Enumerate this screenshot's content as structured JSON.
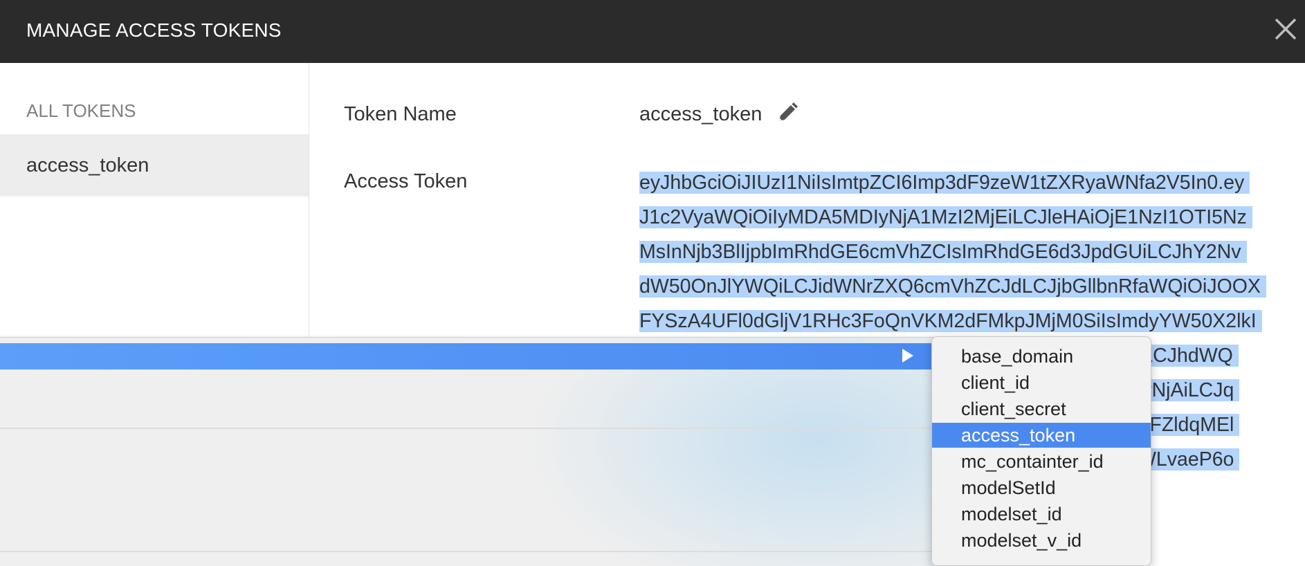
{
  "dialog": {
    "title": "MANAGE ACCESS TOKENS",
    "close_icon": "close-icon"
  },
  "sidebar": {
    "header": "ALL TOKENS",
    "items": [
      {
        "label": "access_token",
        "selected": true
      }
    ]
  },
  "detail": {
    "token_name_label": "Token Name",
    "token_name_value": "access_token",
    "edit_icon": "pencil-icon",
    "access_token_label": "Access Token",
    "access_token_lines": [
      "eyJhbGciOiJIUzI1NiIsImtpZCI6Imp3dF9zeW1tZXRyaWNfa2V5In0.ey",
      "J1c2VyaWQiOiIyMDA5MDIyNjA1MzI2MjEiLCJleHAiOjE1NzI1OTI5Nz",
      "MsInNjb3BlIjpbImRhdGE6cmVhZCIsImRhdGE6d3JpdGUiLCJhY2Nv",
      "dW50OnJlYWQiLCJidWNrZXQ6cmVhZCJdLCJjbGllbnRfaWQiOiJOOX",
      "FYSzA4UFl0dGljV1RHc3FoQnVKM2dFMkpJMjM0SiIsImdyYW50X2lkI",
      "iLCJhdWQ",
      "wNjAiLCJq",
      "FFZldqMEl",
      "WLvaeP6o"
    ],
    "selection_color": "#b3d4fc"
  },
  "context_menu": {
    "highlight_color": "#4a8af0",
    "submenu_arrow_icon": "triangle-right-icon",
    "submenu": {
      "options": [
        "base_domain",
        "client_id",
        "client_secret",
        "access_token",
        "mc_containter_id",
        "modelSetId",
        "modelset_id",
        "modelset_v_id"
      ],
      "selected": "access_token"
    }
  }
}
